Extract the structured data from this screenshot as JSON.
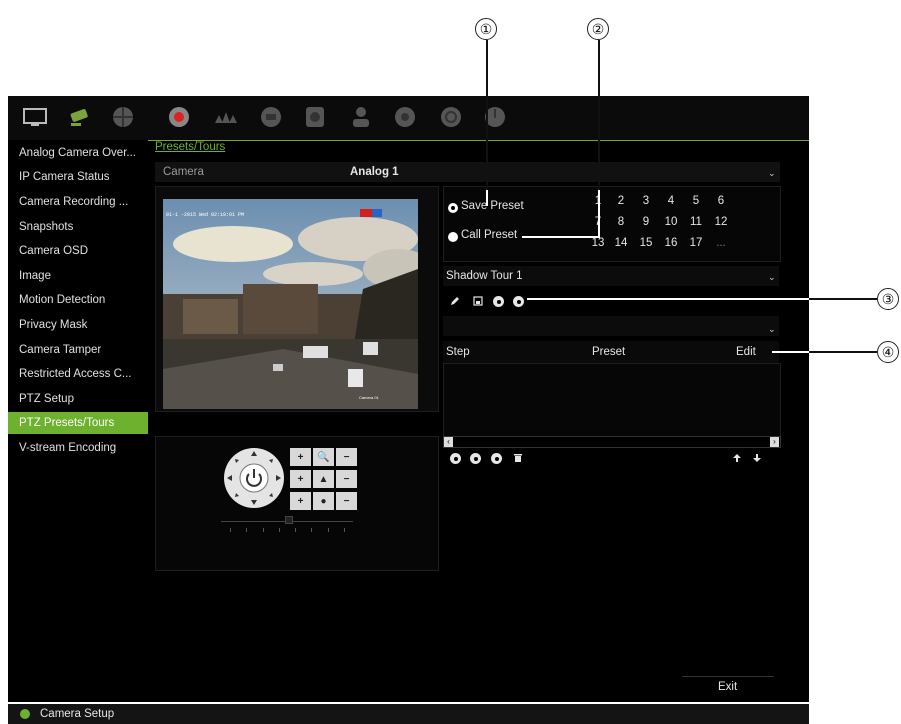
{
  "callouts": [
    "①",
    "②",
    "③",
    "④"
  ],
  "sidebar": {
    "items": [
      {
        "label": "Analog Camera Over..."
      },
      {
        "label": "IP Camera Status"
      },
      {
        "label": "Camera Recording ..."
      },
      {
        "label": "Snapshots"
      },
      {
        "label": "Camera OSD"
      },
      {
        "label": "Image"
      },
      {
        "label": "Motion Detection"
      },
      {
        "label": "Privacy Mask"
      },
      {
        "label": "Camera Tamper"
      },
      {
        "label": "Restricted Access C..."
      },
      {
        "label": "PTZ Setup"
      },
      {
        "label": "PTZ Presets/Tours",
        "active": true
      },
      {
        "label": "V-stream Encoding"
      }
    ]
  },
  "main": {
    "tab": "Presets/Tours",
    "camera_label": "Camera",
    "camera_value": "Analog 1",
    "video_timestamp": "01-1 -2015 Wed 02:10:01 PM",
    "video_camera_name": "Camera 01"
  },
  "presets": {
    "save_label": "Save Preset",
    "call_label": "Call Preset",
    "rows": [
      [
        "1",
        "2",
        "3",
        "4",
        "5",
        "6"
      ],
      [
        "7",
        "8",
        "9",
        "10",
        "11",
        "12"
      ],
      [
        "13",
        "14",
        "15",
        "16",
        "17",
        "..."
      ]
    ]
  },
  "tour": {
    "shadow_tour_value": "Shadow Tour 1",
    "tour_value": "",
    "columns": {
      "step": "Step",
      "preset": "Preset",
      "edit": "Edit"
    }
  },
  "footer": {
    "exit_label": "Exit",
    "status_label": "Camera Setup",
    "status_color": "#6eb12f"
  },
  "colors": {
    "accent": "#6eb12f",
    "background": "#000000"
  }
}
